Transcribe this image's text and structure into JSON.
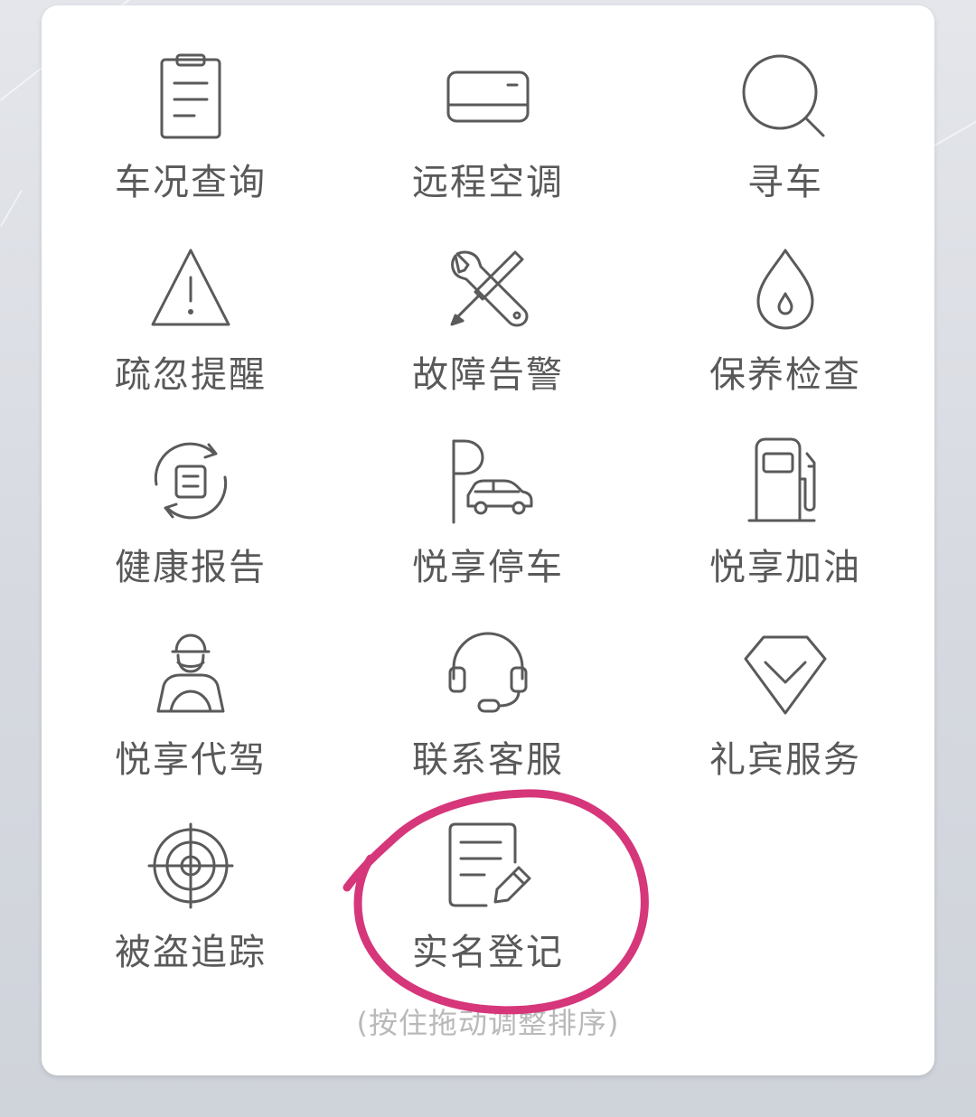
{
  "services": [
    {
      "label": "车况查询",
      "icon": "clipboard-icon"
    },
    {
      "label": "远程空调",
      "icon": "air-conditioner-icon"
    },
    {
      "label": "寻车",
      "icon": "search-icon"
    },
    {
      "label": "疏忽提醒",
      "icon": "warning-icon"
    },
    {
      "label": "故障告警",
      "icon": "wrench-screwdriver-icon"
    },
    {
      "label": "保养检查",
      "icon": "oil-drop-icon"
    },
    {
      "label": "健康报告",
      "icon": "report-refresh-icon"
    },
    {
      "label": "悦享停车",
      "icon": "parking-car-icon"
    },
    {
      "label": "悦享加油",
      "icon": "fuel-pump-icon"
    },
    {
      "label": "悦享代驾",
      "icon": "driver-icon"
    },
    {
      "label": "联系客服",
      "icon": "headset-icon"
    },
    {
      "label": "礼宾服务",
      "icon": "diamond-icon"
    },
    {
      "label": "被盗追踪",
      "icon": "target-icon"
    },
    {
      "label": "实名登记",
      "icon": "document-edit-icon"
    }
  ],
  "hint": "(按住拖动调整排序)",
  "colors": {
    "icon_stroke": "#5a5a5a",
    "label_text": "#595959",
    "hint_text": "#b9b9b9",
    "annotation_circle": "#d6367a"
  }
}
